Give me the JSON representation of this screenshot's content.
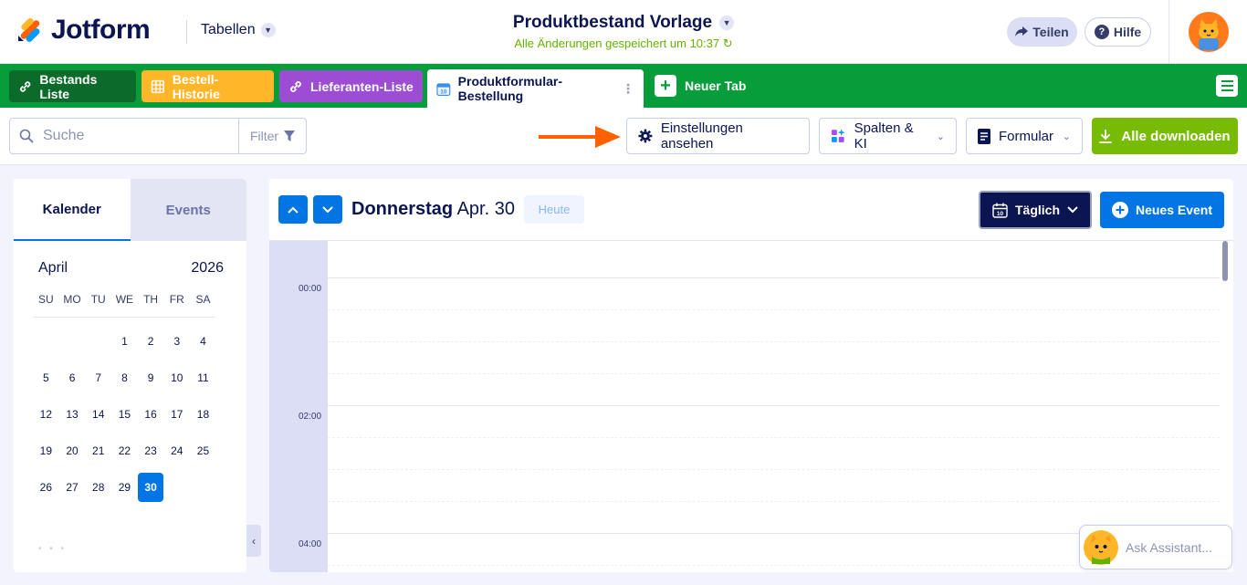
{
  "header": {
    "logo_text": "Jotform",
    "section_label": "Tabellen",
    "title": "Produktbestand Vorlage",
    "save_status": "Alle Änderungen gespeichert um 10:37",
    "share_label": "Teilen",
    "help_label": "Hilfe"
  },
  "tabs": [
    {
      "label": "Bestands Liste",
      "icon": "link-icon",
      "color": "#0c6b2b"
    },
    {
      "label": "Bestell-Historie",
      "icon": "table-grid-icon",
      "color": "#ffb629"
    },
    {
      "label": "Lieferanten-Liste",
      "icon": "link-icon",
      "color": "#9c4dd3"
    },
    {
      "label": "Produktformular-Bestellung",
      "icon": "calendar-icon",
      "active": true
    },
    {
      "label": "Neuer Tab",
      "icon": "plus-icon"
    }
  ],
  "toolbar": {
    "search_placeholder": "Suche",
    "filter_label": "Filter",
    "settings_label": "Einstellungen ansehen",
    "columns_label": "Spalten & KI",
    "form_label": "Formular",
    "download_label": "Alle downloaden"
  },
  "sidebar": {
    "tab_calendar": "Kalender",
    "tab_events": "Events",
    "month": "April",
    "year": "2026",
    "weekdays": [
      "SU",
      "MO",
      "TU",
      "WE",
      "TH",
      "FR",
      "SA"
    ],
    "weeks": [
      [
        "",
        "",
        "",
        "1",
        "2",
        "3",
        "4"
      ],
      [
        "5",
        "6",
        "7",
        "8",
        "9",
        "10",
        "11"
      ],
      [
        "12",
        "13",
        "14",
        "15",
        "16",
        "17",
        "18"
      ],
      [
        "19",
        "20",
        "21",
        "22",
        "23",
        "24",
        "25"
      ],
      [
        "26",
        "27",
        "28",
        "29",
        "30",
        "",
        ""
      ]
    ],
    "selected_day": "30"
  },
  "calendar": {
    "weekday": "Donnerstag",
    "date": "Apr. 30",
    "today_label": "Heute",
    "view_label": "Täglich",
    "new_event_label": "Neues Event",
    "time_labels": [
      "00:00",
      "02:00",
      "04:00"
    ]
  },
  "assistant": {
    "label": "Ask Assistant..."
  },
  "colors": {
    "brand_green": "#079d3a",
    "accent_blue": "#0075e3",
    "download_green": "#78bb07",
    "navy": "#0a1551",
    "annotation_arrow": "#ff6100"
  }
}
